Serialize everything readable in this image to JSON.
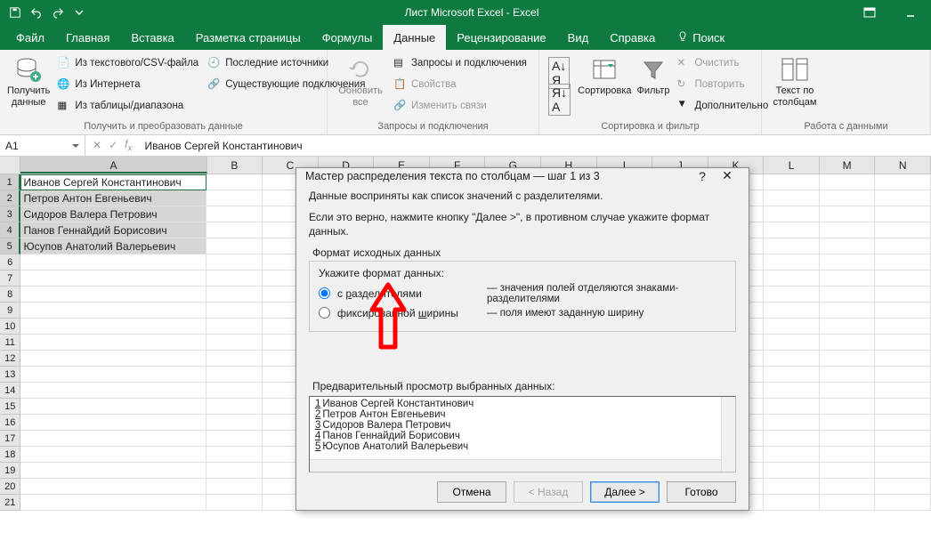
{
  "titlebar": {
    "title": "Лист Microsoft Excel  -  Excel"
  },
  "tabs": {
    "file": "Файл",
    "home": "Главная",
    "insert": "Вставка",
    "layout": "Разметка страницы",
    "formulas": "Формулы",
    "data": "Данные",
    "review": "Рецензирование",
    "view": "Вид",
    "help": "Справка",
    "search": "Поиск"
  },
  "ribbon": {
    "g1": {
      "big": "Получить данные",
      "items": [
        "Из текстового/CSV-файла",
        "Из Интернета",
        "Из таблицы/диапазона",
        "Последние источники",
        "Существующие подключения"
      ],
      "label": "Получить и преобразовать данные"
    },
    "g2": {
      "big": "Обновить все",
      "items": [
        "Запросы и подключения",
        "Свойства",
        "Изменить связи"
      ],
      "label": "Запросы и подключения"
    },
    "g3": {
      "sort": "Сортировка",
      "filter": "Фильтр",
      "clear": "Очистить",
      "reapply": "Повторить",
      "adv": "Дополнительно",
      "label": "Сортировка и фильтр"
    },
    "g4": {
      "big": "Текст по столбцам",
      "label": "Работа с данными"
    }
  },
  "formula_bar": {
    "name_box": "A1",
    "value": "Иванов Сергей Константинович"
  },
  "grid": {
    "columns": [
      "A",
      "B",
      "C",
      "D",
      "E",
      "F",
      "G",
      "H",
      "I",
      "J",
      "K",
      "L",
      "M",
      "N"
    ],
    "col_widths": {
      "A": 214,
      "default": 64
    },
    "data": [
      "Иванов Сергей Константинович",
      "Петров Антон Евгеньевич",
      "Сидоров Валера Петрович",
      "Панов Геннайдий Борисович",
      "Юсупов Анатолий Валерьевич"
    ],
    "visible_rows": 21
  },
  "dialog": {
    "title": "Мастер распределения текста по столбцам — шаг 1 из 3",
    "line1": "Данные восприняты как список значений с разделителями.",
    "line2": "Если это верно, нажмите кнопку \"Далее >\", в противном случае укажите формат данных.",
    "fieldset_title": "Формат исходных данных",
    "prompt": "Укажите формат данных:",
    "opt1": {
      "label": "с разделителями",
      "desc": "— значения полей отделяются знаками-разделителями",
      "u": "р"
    },
    "opt2": {
      "label": "фиксированной ширины",
      "desc": "— поля имеют заданную ширину",
      "u": "ш"
    },
    "preview_title": "Предварительный просмотр выбранных данных:",
    "preview": [
      "Иванов Сергей Константинович",
      "Петров Антон Евгеньевич",
      "Сидоров Валера Петрович",
      "Панов Геннайдий Борисович",
      "Юсупов Анатолий Валерьевич"
    ],
    "buttons": {
      "cancel": "Отмена",
      "back": "< Назад",
      "next": "Далее >",
      "finish": "Готово"
    }
  }
}
